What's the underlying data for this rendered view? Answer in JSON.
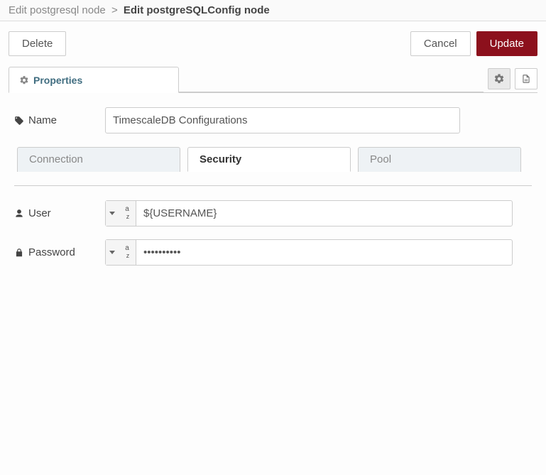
{
  "breadcrumb": {
    "parent": "Edit postgresql node",
    "separator": ">",
    "current": "Edit postgreSQLConfig node"
  },
  "buttons": {
    "delete": "Delete",
    "cancel": "Cancel",
    "update": "Update"
  },
  "tabs": {
    "properties": "Properties"
  },
  "fields": {
    "name_label": "Name",
    "name_value": "TimescaleDB Configurations",
    "user_label": "User",
    "user_value": "${USERNAME}",
    "password_label": "Password",
    "password_value": "••••••••••"
  },
  "inner_tabs": {
    "connection": "Connection",
    "security": "Security",
    "pool": "Pool"
  },
  "icons": {
    "gear": "gear-icon",
    "file": "file-icon",
    "tag": "tag-icon",
    "user": "user-icon",
    "lock": "lock-icon",
    "az": "string-type-icon",
    "caret": "caret-down-icon"
  }
}
